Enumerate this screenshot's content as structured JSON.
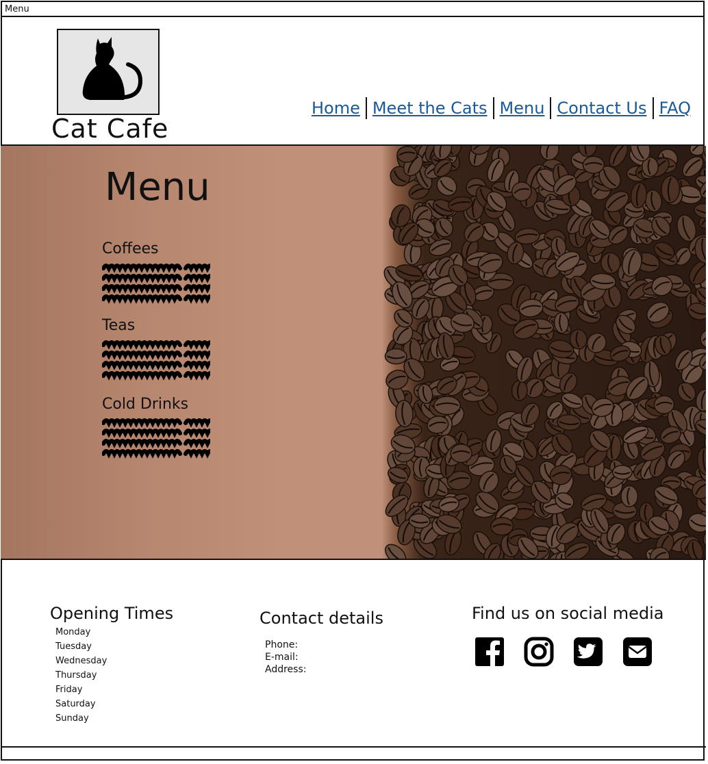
{
  "window": {
    "title": "Menu"
  },
  "header": {
    "brand_name": "Cat Cafe",
    "logo_icon": "cat-silhouette-icon",
    "nav": [
      {
        "label": "Home"
      },
      {
        "label": "Meet the Cats"
      },
      {
        "label": "Menu"
      },
      {
        "label": "Contact Us"
      },
      {
        "label": "FAQ"
      }
    ],
    "link_color": "#1a5a96"
  },
  "hero": {
    "title": "Menu",
    "background": "coffee-beans-photo",
    "sections": [
      {
        "title": "Coffees"
      },
      {
        "title": "Teas"
      },
      {
        "title": "Cold Drinks"
      }
    ]
  },
  "footer": {
    "opening_times": {
      "title": "Opening Times",
      "days": [
        "Monday",
        "Tuesday",
        "Wednesday",
        "Thursday",
        "Friday",
        "Saturday",
        "Sunday"
      ]
    },
    "contact": {
      "title": "Contact details",
      "phone_label": "Phone:",
      "email_label": "E-mail:",
      "address_label": "Address:"
    },
    "social": {
      "title": "Find us on social media",
      "icons": [
        "facebook-icon",
        "instagram-icon",
        "twitter-icon",
        "email-icon"
      ]
    }
  }
}
